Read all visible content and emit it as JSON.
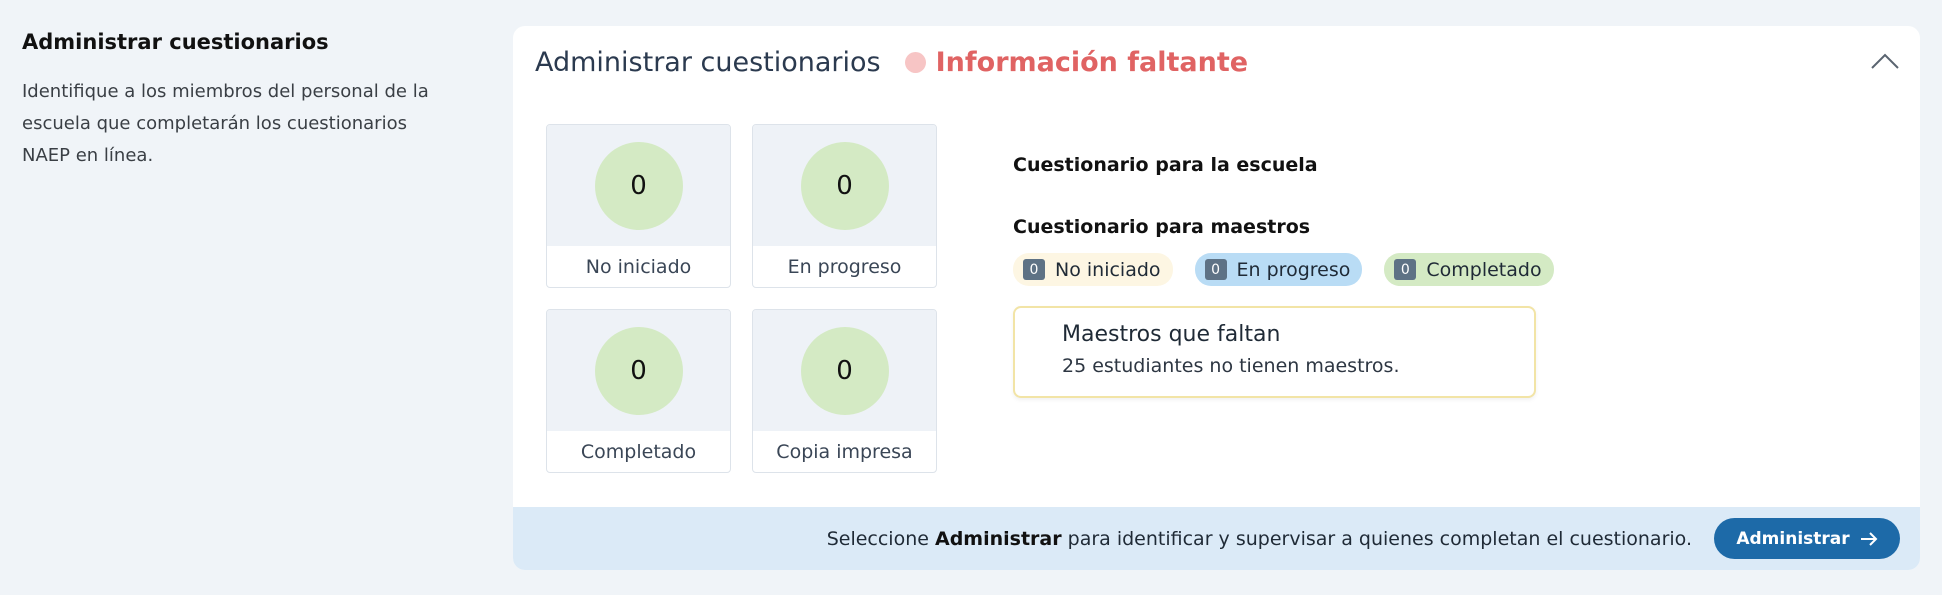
{
  "intro": {
    "title": "Administrar cuestionarios",
    "description": "Identifique a los miembros del personal de la escuela que completarán los cuestionarios NAEP en línea."
  },
  "card": {
    "title": "Administrar cuestionarios",
    "status": "Información faltante",
    "status_color": "#e06363",
    "collapse_icon": "chevron-up-icon"
  },
  "tiles": [
    {
      "value": "0",
      "label": "No iniciado"
    },
    {
      "value": "0",
      "label": "En progreso"
    },
    {
      "value": "0",
      "label": "Completado"
    },
    {
      "value": "0",
      "label": "Copia impresa"
    }
  ],
  "questionnaires": {
    "school_label": "Cuestionario para la escuela",
    "teachers_label": "Cuestionario para maestros",
    "chips": [
      {
        "count": "0",
        "label": "No iniciado"
      },
      {
        "count": "0",
        "label": "En progreso"
      },
      {
        "count": "0",
        "label": "Completado"
      }
    ]
  },
  "alert": {
    "title": "Maestros que faltan",
    "body": "25 estudiantes no tienen maestros."
  },
  "footer": {
    "text_before": "Seleccione ",
    "text_bold": "Administrar",
    "text_after": " para identificar y supervisar a quienes completan el cuestionario.",
    "button_label": "Administrar",
    "button_icon": "arrow-right-icon",
    "accent": "#1d6aa8"
  }
}
